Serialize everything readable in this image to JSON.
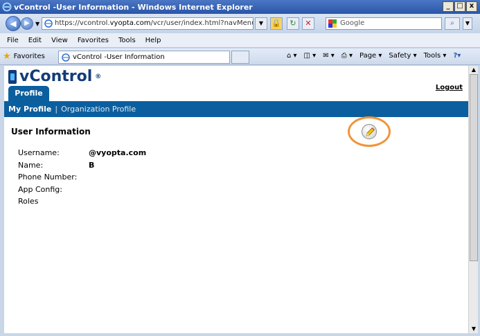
{
  "window": {
    "title": "vControl -User Information - Windows Internet Explorer",
    "min": "_",
    "max": "□",
    "close": "x"
  },
  "address": {
    "url_prefix": "https://vcontrol.",
    "url_domain": "vyopta.com",
    "url_suffix": "/vcr/user/index.html?navMenu=enc"
  },
  "search": {
    "placeholder": "Google"
  },
  "menu": [
    "File",
    "Edit",
    "View",
    "Favorites",
    "Tools",
    "Help"
  ],
  "favorites": {
    "label": "Favorites"
  },
  "tab": {
    "title": "vControl -User Information"
  },
  "commandbar": {
    "page": "Page",
    "safety": "Safety",
    "tools": "Tools"
  },
  "app": {
    "logo": "vControl",
    "logo_mark": "®",
    "profile_tab": "Profile",
    "logout": "Logout",
    "nav": {
      "my_profile": "My Profile",
      "separator": "|",
      "org_profile": "Organization Profile"
    },
    "section_title": "User Information",
    "fields": [
      {
        "label": "Username:",
        "value": "@vyopta.com"
      },
      {
        "label": "Name:",
        "value": "B"
      },
      {
        "label": "Phone Number:",
        "value": ""
      },
      {
        "label": "App Config:",
        "value": ""
      },
      {
        "label": "Roles",
        "value": ""
      }
    ]
  },
  "colors": {
    "brand": "#0c5f9e",
    "highlight": "#f0953a"
  }
}
